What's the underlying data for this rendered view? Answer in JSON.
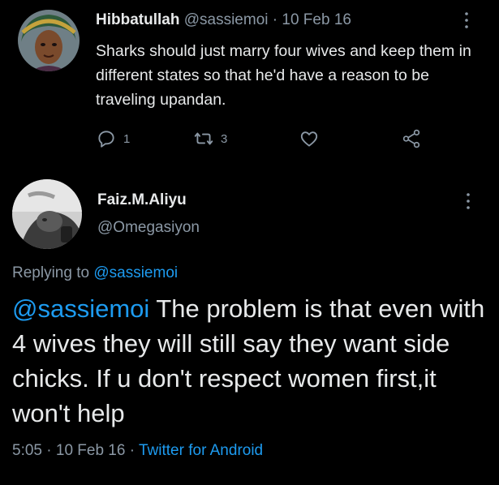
{
  "tweet1": {
    "author_name": "Hibbatullah",
    "author_handle": "@sassiemoi",
    "separator": "·",
    "date": "10 Feb 16",
    "text": "Sharks should just marry four wives and keep them in different states so that he'd have a reason to be traveling upandan.",
    "reply_count": "1",
    "retweet_count": "3",
    "icons": [
      "reply-icon",
      "retweet-icon",
      "like-icon",
      "share-icon",
      "more-icon"
    ]
  },
  "tweet2": {
    "author_name": "Faiz.M.Aliyu",
    "author_handle": "@Omegasiyon",
    "replying_prefix": "Replying to",
    "replying_handle": "@sassiemoi",
    "mention": "@sassiemoi",
    "text": " The problem is that even with 4 wives they will still say they want side chicks. If u don't respect women first,it won't help",
    "time": "5:05",
    "separator": "·",
    "date": "10 Feb 16",
    "source": "Twitter for Android"
  },
  "colors": {
    "background": "#000000",
    "text": "#e7e9ea",
    "muted": "#8b98a5",
    "link": "#1d9bf0"
  }
}
